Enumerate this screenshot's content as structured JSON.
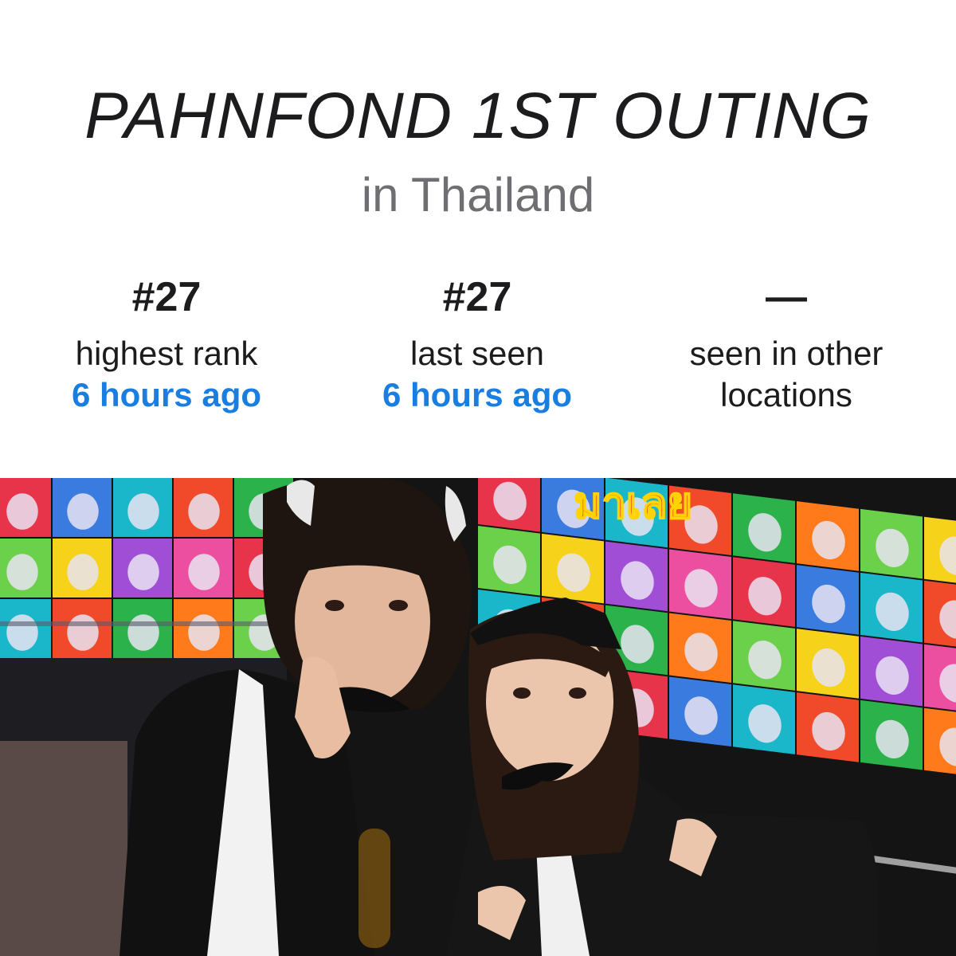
{
  "header": {
    "title": "PAHNFOND 1ST OUTING",
    "subtitle": "in Thailand"
  },
  "stats": [
    {
      "value": "#27",
      "label": "highest rank",
      "time": "6 hours ago"
    },
    {
      "value": "#27",
      "label": "last seen",
      "time": "6 hours ago"
    },
    {
      "value": "—",
      "label": "seen in other locations"
    }
  ],
  "photo": {
    "sign_text": "มาเลย"
  },
  "colors": {
    "accent": "#1a7ee0",
    "text": "#1c1c1e",
    "muted": "#6e6e73"
  }
}
